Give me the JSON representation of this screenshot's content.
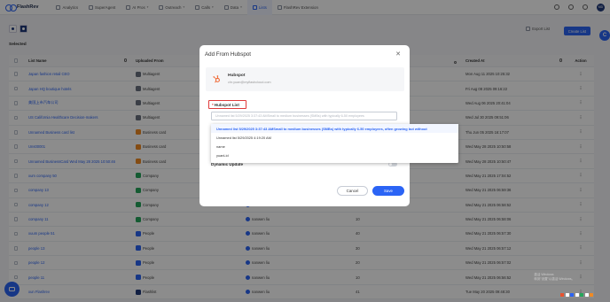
{
  "app": {
    "brand": "FlashRev",
    "nav": [
      {
        "label": "Analytics"
      },
      {
        "label": "SuperAgent"
      },
      {
        "label": "AI Pros",
        "caret": true
      },
      {
        "label": "Outreach",
        "caret": true
      },
      {
        "label": "Calls",
        "caret": true
      },
      {
        "label": "Data",
        "caret": true
      },
      {
        "label": "Lists",
        "active": true
      },
      {
        "label": "FlashRev Extension"
      }
    ],
    "avatar_initials": "MD"
  },
  "toolbar": {
    "selected_label": "Selected",
    "export_label": "Export List",
    "create_label": "Create List",
    "side_fab": "C"
  },
  "table": {
    "headers": {
      "name": "List Name",
      "from": "Uploaded From",
      "owner": "",
      "count": "",
      "created": "Created At",
      "action": "Action"
    },
    "rows": [
      {
        "name": "Japan fashion retail CEO",
        "from": "Multiagent",
        "src": "gray",
        "owner": "",
        "count": "",
        "created": "Mon Aug 11 2025 10:25:32"
      },
      {
        "name": "Japan HQ boutique hotels",
        "from": "Multiagent",
        "src": "gray",
        "owner": "",
        "count": "",
        "created": "Fri Aug 08 2025 09:16:22"
      },
      {
        "name": "美国上市汽车公司",
        "from": "Multiagent",
        "src": "gray",
        "owner": "",
        "count": "",
        "created": "Wed Aug 06 2025 20:41:04"
      },
      {
        "name": "US California Healthcare Decision-makers",
        "from": "Multiagent",
        "src": "gray",
        "owner": "",
        "count": "",
        "created": "Wed Jul 30 2025 09:51:06"
      },
      {
        "name": "Unnamed Business card list",
        "from": "Business card",
        "src": "orange",
        "owner": "",
        "count": "",
        "created": "Thu Jun 05 2025 16:17:07"
      },
      {
        "name": "Uns00001",
        "from": "Business card",
        "src": "orange",
        "owner": "",
        "count": "",
        "created": "Wed May 28 2025 10:50:58"
      },
      {
        "name": "Unnamed BusinessCard Wed May 28 2025 10:50:46",
        "from": "Business card",
        "src": "orange",
        "owner": "",
        "count": "",
        "created": "Wed May 28 2025 10:50:47"
      },
      {
        "name": "xum company 50",
        "from": "Company",
        "src": "green",
        "owner": "",
        "count": "",
        "created": "Wed May 21 2025 17:04:52"
      },
      {
        "name": "company 13",
        "from": "Company",
        "src": "green",
        "owner": "nanwen liu",
        "count": "30",
        "created": "Wed May 21 2025 06:59:36"
      },
      {
        "name": "company 12",
        "from": "Company",
        "src": "green",
        "owner": "nanwen liu",
        "count": "20",
        "created": "Wed May 21 2025 06:58:52"
      },
      {
        "name": "company 11",
        "from": "Company",
        "src": "green",
        "owner": "nanwen liu",
        "count": "10",
        "created": "Wed May 21 2025 06:58:06"
      },
      {
        "name": "xuum people 51",
        "from": "People",
        "src": "blue",
        "owner": "nanwen liu",
        "count": "40",
        "created": "Wed May 21 2025 06:57:30"
      },
      {
        "name": "people 13",
        "from": "People",
        "src": "blue",
        "owner": "nanwen liu",
        "count": "30",
        "created": "Wed May 21 2025 06:57:12"
      },
      {
        "name": "people 12",
        "from": "People",
        "src": "blue",
        "owner": "nanwen liu",
        "count": "20",
        "created": "Wed May 21 2025 06:57:02"
      },
      {
        "name": "people 11",
        "from": "People",
        "src": "blue",
        "owner": "nanwen liu",
        "count": "10",
        "created": "Wed May 21 2025 06:56:52"
      },
      {
        "name": "xun Flashrev",
        "from": "Flashlist",
        "src": "navy",
        "owner": "nanwen liu",
        "count": "41",
        "created": "Tue May 20 2025 09:48:30"
      }
    ]
  },
  "modal": {
    "title": "Add From Hubspot",
    "close_glyph": "✕",
    "account": {
      "name": "Hubspot",
      "email": "chr.yuan@myflashcloud.com"
    },
    "list_label": "Hubspot List",
    "required_mark": "*",
    "select_placeholder": "Unnamed list 5/29/2025 3:37:43 AMSmall to medium businesses (SMBs) with typically 6-50 employees",
    "dynamic_label": "Dynamic Update",
    "cancel_label": "Cancel",
    "save_label": "Save"
  },
  "dropdown": {
    "options": [
      {
        "label": "Unnamed list 5/29/2025 3:37:43 AMSmall to medium businesses (SMBs) with typically 6-50 employees, often growing but without",
        "selected": true
      },
      {
        "label": "Unnamed list 5/29/2025 4:19:20 AM",
        "selected": false
      },
      {
        "label": "name",
        "selected": false
      },
      {
        "label": "yuanLid",
        "selected": false
      }
    ]
  },
  "colors": {
    "accent": "#2b64f5",
    "required": "#e03a3a",
    "src_gray": "#6b7280",
    "src_orange": "#f08a24",
    "src_green": "#26a65b",
    "src_blue": "#2b64f5",
    "src_navy": "#1f3a7a"
  },
  "icons": {
    "hubspot": "hubspot-logo-icon",
    "chat": "chat-bubble-icon",
    "search": "search-icon",
    "more": "more-vertical-icon"
  },
  "watermark": {
    "line1": "激活 Windows",
    "line2": "转到\"设置\"以激活 Windows。"
  }
}
